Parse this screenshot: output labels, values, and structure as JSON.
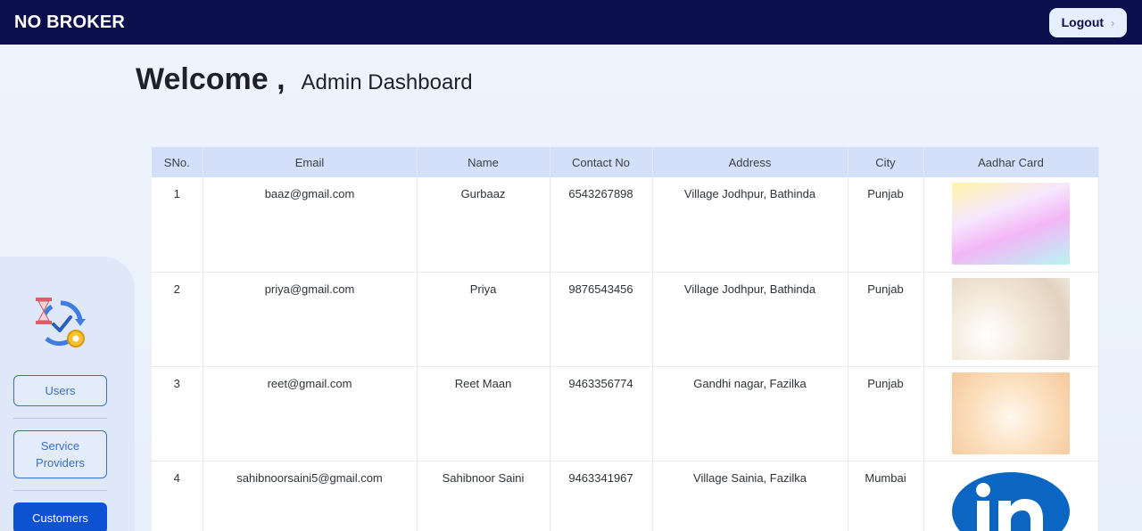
{
  "header": {
    "brand": "NO BROKER",
    "logout_label": "Logout",
    "logout_icon": "chevron-right-icon"
  },
  "welcome": {
    "greeting": "Welcome ,",
    "subtitle": "Admin Dashboard"
  },
  "sidebar": {
    "logo_icon": "hourglass-cycle-gear-icon",
    "items": [
      {
        "label": "Users",
        "active": false
      },
      {
        "label": "Service\nProviders",
        "active": false
      },
      {
        "label": "Customers",
        "active": true
      }
    ]
  },
  "table": {
    "columns": [
      "SNo.",
      "Email",
      "Name",
      "Contact No",
      "Address",
      "City",
      "Aadhar Card"
    ],
    "rows": [
      {
        "sno": "1",
        "email": "baaz@gmail.com",
        "name": "Gurbaaz",
        "contact": "6543267898",
        "address": "Village Jodhpur, Bathinda",
        "city": "Punjab",
        "aadhar": "pastel-gradient-image"
      },
      {
        "sno": "2",
        "email": "priya@gmail.com",
        "name": "Priya",
        "contact": "9876543456",
        "address": "Village Jodhpur, Bathinda",
        "city": "Punjab",
        "aadhar": "bokeh-image"
      },
      {
        "sno": "3",
        "email": "reet@gmail.com",
        "name": "Reet Maan",
        "contact": "9463356774",
        "address": "Gandhi nagar, Fazilka",
        "city": "Punjab",
        "aadhar": "peach-gradient-image"
      },
      {
        "sno": "4",
        "email": "sahibnoorsaini5@gmail.com",
        "name": "Sahibnoor Saini",
        "contact": "9463341967",
        "address": "Village Sainia, Fazilka",
        "city": "Mumbai",
        "aadhar": "linkedin-logo-image"
      }
    ]
  },
  "colors": {
    "topbar": "#0b0f4c",
    "accent": "#0e52d4",
    "linkedin": "#0a66c2"
  }
}
